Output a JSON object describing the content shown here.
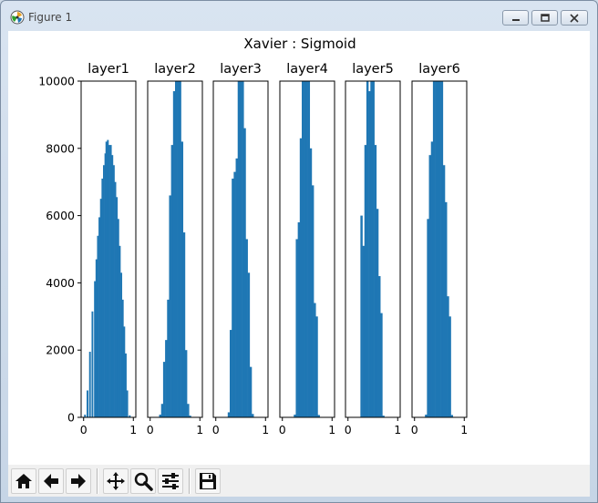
{
  "window": {
    "title": "Figure 1",
    "icon": "matplotlib-icon",
    "controls": [
      "minimize-icon",
      "maximize-icon",
      "close-icon"
    ]
  },
  "toolbar": {
    "buttons": [
      "home-icon",
      "back-arrow-icon",
      "forward-arrow-icon",
      "pan-move-icon",
      "zoom-magnifier-icon",
      "configure-subplots-icon",
      "save-floppy-icon"
    ]
  },
  "colors": {
    "bar": "#1f77b4",
    "axes_edge": "#000000",
    "background": "#ffffff"
  },
  "chart_data": {
    "type": "bar",
    "suptitle": "Xavier : Sigmoid",
    "xlim": [
      -0.05,
      1.05
    ],
    "ylim": [
      0,
      10000
    ],
    "x_ticks": [
      "0",
      "1"
    ],
    "y_ticks": [
      "0",
      "2000",
      "4000",
      "6000",
      "8000",
      "10000"
    ],
    "y_tick_values": [
      0,
      2000,
      4000,
      6000,
      8000,
      10000
    ],
    "grid": false,
    "series": [
      {
        "name": "layer1",
        "x": [
          0.025,
          0.075,
          0.125,
          0.175,
          0.225,
          0.255,
          0.285,
          0.315,
          0.345,
          0.375,
          0.405,
          0.435,
          0.455,
          0.485,
          0.515,
          0.545,
          0.575,
          0.605,
          0.635,
          0.665,
          0.695,
          0.725,
          0.755,
          0.785,
          0.815,
          0.845,
          0.875,
          0.925
        ],
        "values": [
          80,
          800,
          1950,
          3150,
          4050,
          4700,
          5400,
          5950,
          6500,
          7100,
          7500,
          7850,
          8200,
          8250,
          8100,
          8100,
          7800,
          7500,
          7000,
          6550,
          5900,
          5100,
          4300,
          3500,
          2700,
          1900,
          800,
          60
        ],
        "bin_width": 0.03
      },
      {
        "name": "layer2",
        "x": [
          0.2,
          0.24,
          0.28,
          0.32,
          0.36,
          0.4,
          0.44,
          0.48,
          0.52,
          0.56,
          0.6,
          0.64,
          0.68,
          0.72,
          0.76,
          0.8
        ],
        "values": [
          80,
          400,
          1650,
          2300,
          3500,
          6600,
          8100,
          9700,
          10000,
          10000,
          10000,
          8200,
          5500,
          2000,
          400,
          50
        ],
        "bin_width": 0.04
      },
      {
        "name": "layer3",
        "x": [
          0.26,
          0.3,
          0.34,
          0.38,
          0.42,
          0.46,
          0.5,
          0.54,
          0.58,
          0.62,
          0.66,
          0.7,
          0.74
        ],
        "values": [
          150,
          2600,
          7100,
          7300,
          7700,
          10000,
          10000,
          10000,
          8600,
          5300,
          4300,
          1500,
          100
        ],
        "bin_width": 0.04
      },
      {
        "name": "layer4",
        "x": [
          0.25,
          0.29,
          0.33,
          0.37,
          0.41,
          0.45,
          0.49,
          0.53,
          0.57,
          0.61,
          0.65,
          0.69,
          0.73
        ],
        "values": [
          80,
          5300,
          5800,
          8300,
          10000,
          10000,
          10000,
          10000,
          8000,
          6900,
          3400,
          3000,
          70
        ],
        "bin_width": 0.04
      },
      {
        "name": "layer5",
        "x": [
          0.27,
          0.31,
          0.35,
          0.39,
          0.43,
          0.47,
          0.51,
          0.55,
          0.59,
          0.63,
          0.67,
          0.71
        ],
        "values": [
          6000,
          5100,
          8100,
          10000,
          9700,
          10000,
          10000,
          8100,
          6200,
          4200,
          3100,
          50
        ],
        "bin_width": 0.04
      },
      {
        "name": "layer6",
        "x": [
          0.23,
          0.27,
          0.31,
          0.35,
          0.39,
          0.43,
          0.47,
          0.51,
          0.55,
          0.59,
          0.63,
          0.67,
          0.71,
          0.75
        ],
        "values": [
          80,
          5900,
          7800,
          8200,
          10000,
          10000,
          10000,
          10000,
          10000,
          7500,
          6400,
          3600,
          3000,
          70
        ],
        "bin_width": 0.04
      }
    ]
  }
}
